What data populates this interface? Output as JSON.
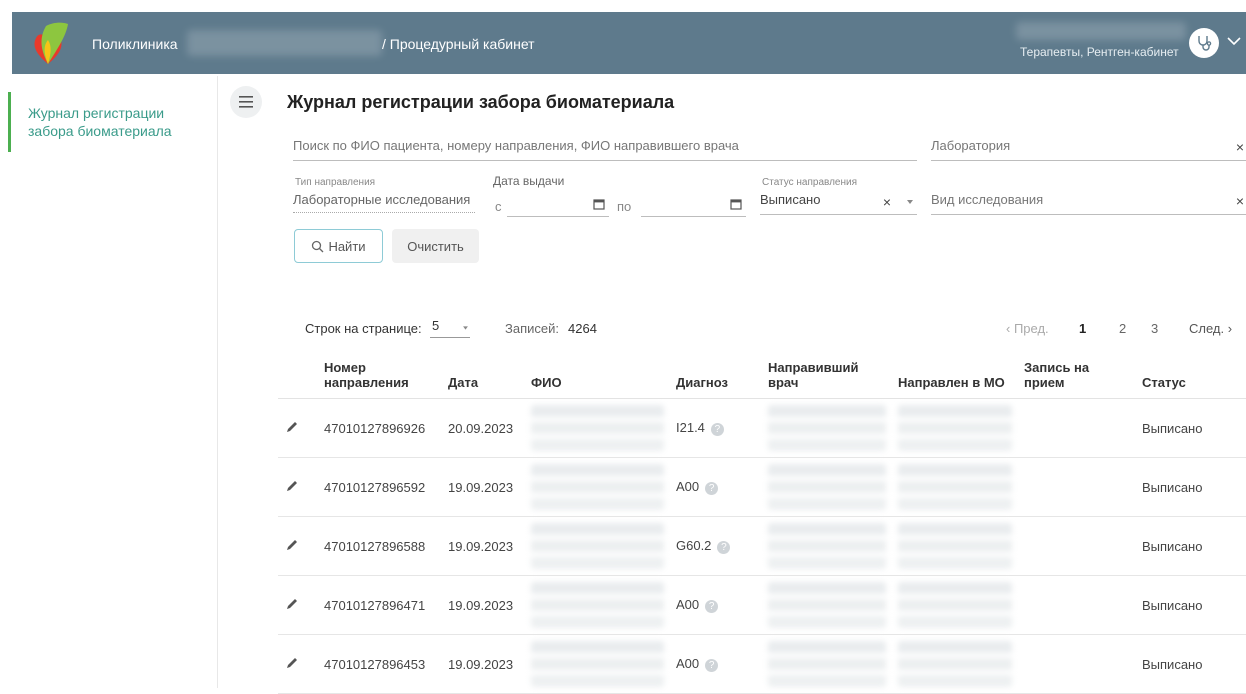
{
  "header": {
    "app_name": "Поликлиника",
    "section": "/ Процедурный кабинет",
    "user_role": "Терапевты, Рентген-кабинет",
    "accent": "#5e7a8c"
  },
  "sidebar": {
    "items": [
      {
        "label": "Журнал регистрации забора биоматериала",
        "active": true
      }
    ]
  },
  "main": {
    "title": "Журнал регистрации забора биоматериала",
    "search_placeholder": "Поиск по ФИО пациента, номеру направления, ФИО направившего врача",
    "lab_placeholder": "Лаборатория",
    "direction_type_label": "Тип направления",
    "direction_type_value": "Лабораторные исследования",
    "issue_date_label": "Дата выдачи",
    "date_from_label": "с",
    "date_to_label": "по",
    "status_label": "Статус направления",
    "status_value": "Выписано",
    "study_type_placeholder": "Вид исследования",
    "find_button": "Найти",
    "clear_button": "Очистить",
    "clear_symbol": "×"
  },
  "table_controls": {
    "rows_per_page_label": "Строк на странице:",
    "rows_per_page_value": "5",
    "records_label": "Записей:",
    "records_count": "4264",
    "prev": "‹ Пред.",
    "pages": [
      "1",
      "2",
      "3"
    ],
    "next": "След. ›"
  },
  "table": {
    "columns": [
      "Номер направления",
      "Дата",
      "ФИО",
      "Диагноз",
      "Направивший врач",
      "Направлен в МО",
      "Запись на прием",
      "Статус"
    ],
    "rows": [
      {
        "number": "47010127896926",
        "date": "20.09.2023",
        "diagnosis": "I21.4",
        "status": "Выписано"
      },
      {
        "number": "47010127896592",
        "date": "19.09.2023",
        "diagnosis": "A00",
        "status": "Выписано"
      },
      {
        "number": "47010127896588",
        "date": "19.09.2023",
        "diagnosis": "G60.2",
        "status": "Выписано"
      },
      {
        "number": "47010127896471",
        "date": "19.09.2023",
        "diagnosis": "A00",
        "status": "Выписано"
      },
      {
        "number": "47010127896453",
        "date": "19.09.2023",
        "diagnosis": "A00",
        "status": "Выписано"
      }
    ]
  }
}
